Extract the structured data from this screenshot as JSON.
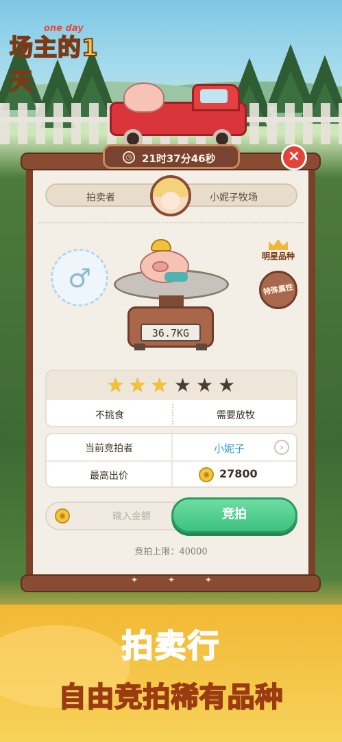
{
  "app": {
    "logo_main": "场主的1天",
    "logo_sub": "one day"
  },
  "auction": {
    "countdown": "21时37分46秒",
    "close_icon": "close-icon",
    "seller_label": "拍卖者",
    "seller_name": "小妮子牧场",
    "gender_symbol": "♂",
    "weight": "36.7KG",
    "star_breed_label": "明星品种",
    "special_attr_label": "特殊属性",
    "rating": {
      "filled": 3,
      "total": 6
    },
    "traits": [
      "不挑食",
      "需要放牧"
    ],
    "current_bidder_label": "当前竞拍者",
    "current_bidder_name": "小妮子",
    "highest_bid_label": "最高出价",
    "highest_bid_value": "27800",
    "bid_input_placeholder": "输入金额",
    "bid_button_label": "竞拍",
    "bid_limit_text": "竞拍上限：40000"
  },
  "promo": {
    "title": "拍卖行",
    "subtitle": "自由竞拍稀有品种"
  },
  "colors": {
    "accent_green": "#3cc27f",
    "close_red": "#e2443a",
    "star_gold": "#f6c12c",
    "bidder_blue": "#2e9ccf"
  }
}
